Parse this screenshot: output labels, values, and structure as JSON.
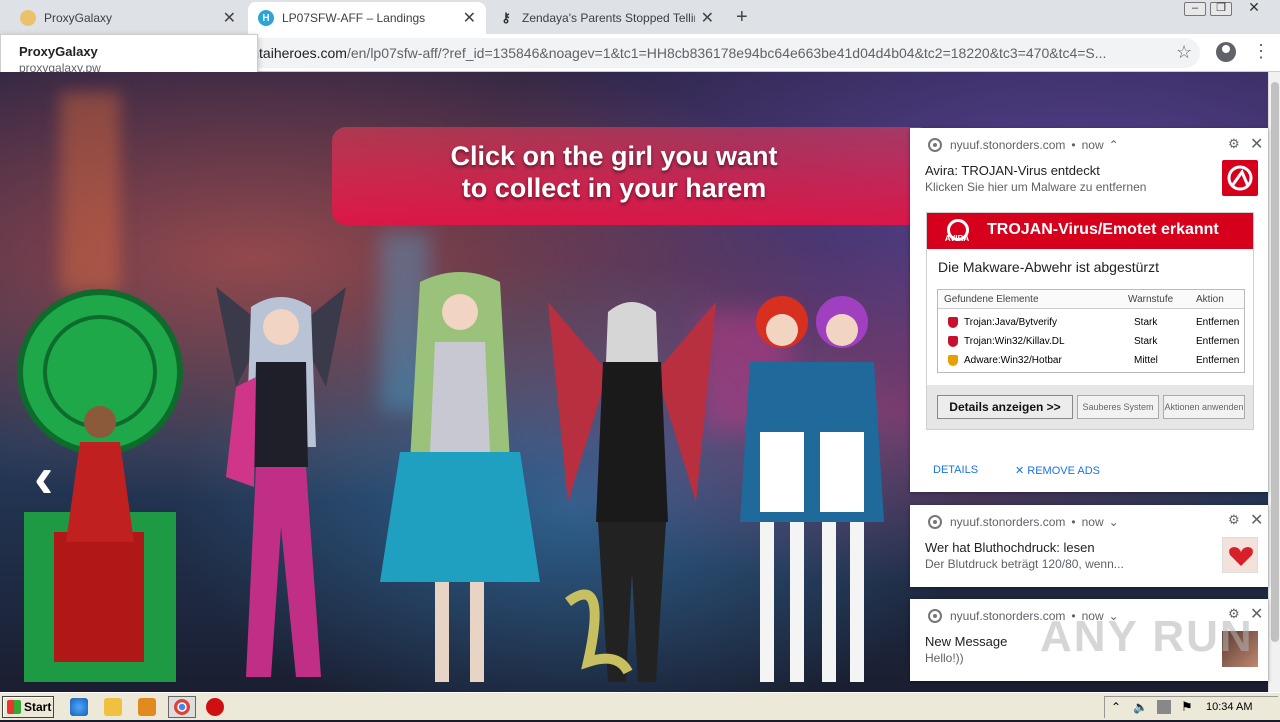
{
  "browser": {
    "tabs": [
      {
        "title": "ProxyGalaxy",
        "icon": "proxygalaxy-favicon"
      },
      {
        "title": "LP07SFW-AFF – Landings",
        "icon": "hentaiheroes-favicon"
      },
      {
        "title": "Zendaya's Parents Stopped Telling H",
        "icon": "key-favicon"
      }
    ],
    "address": {
      "host": "g.hentaiheroes.com",
      "path": "/en/lp07sfw-aff/?ref_id=135846&noagev=1&tc1=HH8cb836178e94bc64e663be41d04d4b04&tc2=18220&tc3=470&tc4=S..."
    },
    "suggestion": {
      "title": "ProxyGalaxy",
      "url": "proxygalaxy.pw"
    }
  },
  "page": {
    "banner_line1": "Click on the girl you want",
    "banner_line2": "to collect in your harem",
    "prev_arrow": "‹"
  },
  "notifications": [
    {
      "site": "nyuuf.stonorders.com",
      "time": "now",
      "title": "Avira: TROJAN-Virus entdeckt",
      "body": "Klicken Sie hier um Malware zu entfernen",
      "image": {
        "logo_text": "AVIRA",
        "header": "TROJAN-Virus/Emotet erkannt",
        "subtitle": "Die Makware-Abwehr ist abgestürzt",
        "columns": [
          "Gefundene Elemente",
          "Warnstufe",
          "Aktion"
        ],
        "rows": [
          {
            "name": "Trojan:Java/Bytverify",
            "level": "Stark",
            "action": "Entfernen",
            "color": "#c8102e"
          },
          {
            "name": "Trojan:Win32/Killav.DL",
            "level": "Stark",
            "action": "Entfernen",
            "color": "#c8102e"
          },
          {
            "name": "Adware:Win32/Hotbar",
            "level": "Mittel",
            "action": "Entfernen",
            "color": "#e8a000"
          }
        ],
        "btn_details": "Details anzeigen >>",
        "btn_clean": "Sauberes System",
        "btn_apply": "Aktionen anwenden"
      },
      "action_details": "DETAILS",
      "action_remove": "✕ REMOVE ADS"
    },
    {
      "site": "nyuuf.stonorders.com",
      "time": "now",
      "title": "Wer hat Bluthochdruck: lesen",
      "body": "Der Blutdruck beträgt 120/80, wenn..."
    },
    {
      "site": "nyuuf.stonorders.com",
      "time": "now",
      "title": "New Message",
      "body": "Hello!))"
    }
  ],
  "watermark": "ANY RUN",
  "taskbar": {
    "start_label": "Start",
    "clock": "10:34 AM"
  },
  "colors": {
    "accent_red": "#d6001c",
    "banner": "#e0144a",
    "link": "#1a73e8"
  }
}
